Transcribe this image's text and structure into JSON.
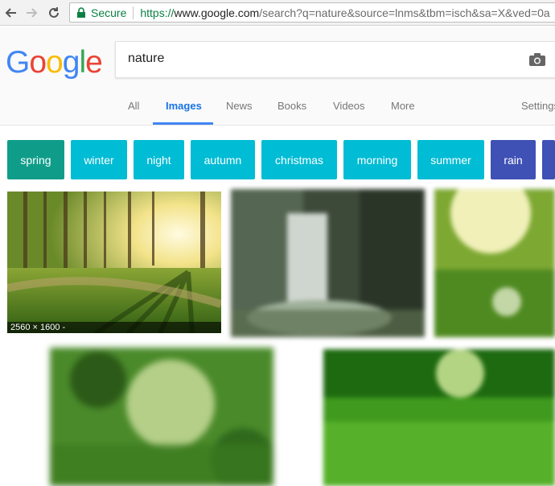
{
  "browser": {
    "secure_label": "Secure",
    "url_scheme": "https://",
    "url_host": "www.google.com",
    "url_rest": "/search?q=nature&source=lnms&tbm=isch&sa=X&ved=0a"
  },
  "search": {
    "query": "nature"
  },
  "tabs": [
    {
      "label": "All"
    },
    {
      "label": "Images"
    },
    {
      "label": "News"
    },
    {
      "label": "Books"
    },
    {
      "label": "Videos"
    },
    {
      "label": "More"
    },
    {
      "label": "Settings"
    }
  ],
  "chips": [
    {
      "label": "spring",
      "color": "#0f9d8a"
    },
    {
      "label": "winter",
      "color": "#00bcd4"
    },
    {
      "label": "night",
      "color": "#00bcd4"
    },
    {
      "label": "autumn",
      "color": "#00bcd4"
    },
    {
      "label": "christmas",
      "color": "#00bcd4"
    },
    {
      "label": "morning",
      "color": "#00bcd4"
    },
    {
      "label": "summer",
      "color": "#00bcd4"
    },
    {
      "label": "rain",
      "color": "#3f51b5"
    }
  ],
  "results": [
    {
      "caption": "2560 × 1600 -"
    }
  ]
}
